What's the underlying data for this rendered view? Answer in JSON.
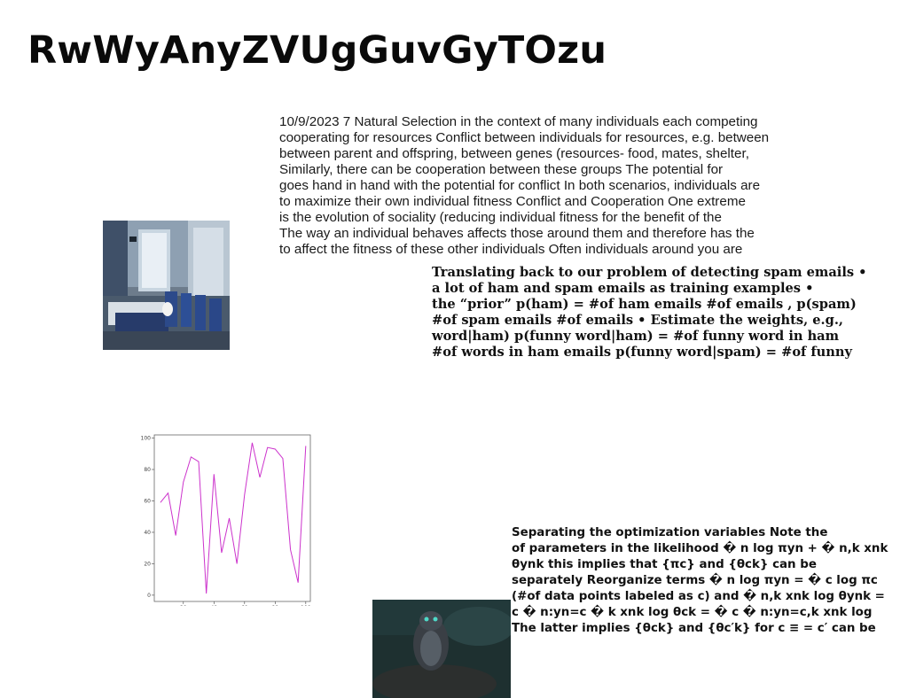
{
  "page": {
    "title": "RwWyAnyZVUgGuvGyTOzu"
  },
  "text_block_1": {
    "lines": [
      "10/9/2023 7 Natural Selection in the context of many individuals each competing",
      "cooperating for resources Conflict between individuals for resources, e.g. between",
      "between parent and offspring, between genes (resources- food, mates, shelter,",
      "Similarly, there can be cooperation between these groups The potential for",
      "goes hand in hand with the potential for conflict In both scenarios, individuals are",
      "to maximize their own individual fitness Conflict and Cooperation One extreme",
      "is the evolution of sociality (reducing individual fitness for the benefit of the",
      "The way an individual behaves affects those around them and therefore has the",
      "to affect the fitness of these other individuals Often individuals around you are"
    ]
  },
  "text_block_2": {
    "lines": [
      "Translating back to our problem of detecting spam emails •",
      "a lot of ham and spam emails as training examples •",
      "the “prior” p(ham) = #of ham emails #of emails , p(spam)",
      "#of spam emails #of emails • Estimate the weights, e.g.,",
      "word|ham) p(funny word|ham) = #of funny word in ham",
      "#of words in ham emails p(funny word|spam) = #of funny"
    ]
  },
  "text_block_3": {
    "lines": [
      "Separating the optimization variables Note the",
      "of parameters in the likelihood � n log πyn + � n,k xnk",
      "θynk this implies that {πc} and {θck} can be",
      "separately Reorganize terms � n log πyn = � c log πc",
      "(#of data points labeled as c) and � n,k xnk log θynk =",
      "c � n:yn=c � k xnk log θck = � c � n:yn=c,k xnk log",
      "The latter implies {θck} and {θc′k} for c ≡ = c′ can be"
    ]
  },
  "images": {
    "dining_room_photo": "dining-room-photo",
    "bird_photo": "owl-on-rock-photo"
  },
  "chart_data": {
    "type": "line",
    "x": [
      5,
      10,
      15,
      20,
      25,
      30,
      35,
      40,
      45,
      50,
      55,
      60,
      65,
      70,
      75,
      80,
      85,
      90,
      95,
      100
    ],
    "series": [
      {
        "values": [
          59,
          65,
          38,
          72,
          88,
          85,
          1,
          77,
          27,
          49,
          20,
          64,
          97,
          75,
          94,
          93,
          87,
          29,
          8,
          95
        ]
      }
    ],
    "xticks": [
      "20",
      "40",
      "60",
      "80",
      "100"
    ],
    "yticks": [
      "0",
      "20",
      "40",
      "60",
      "80",
      "100"
    ],
    "xlim": [
      1,
      103
    ],
    "ylim": [
      -4,
      102
    ],
    "line_color": "#cc33cc",
    "grid": false
  }
}
